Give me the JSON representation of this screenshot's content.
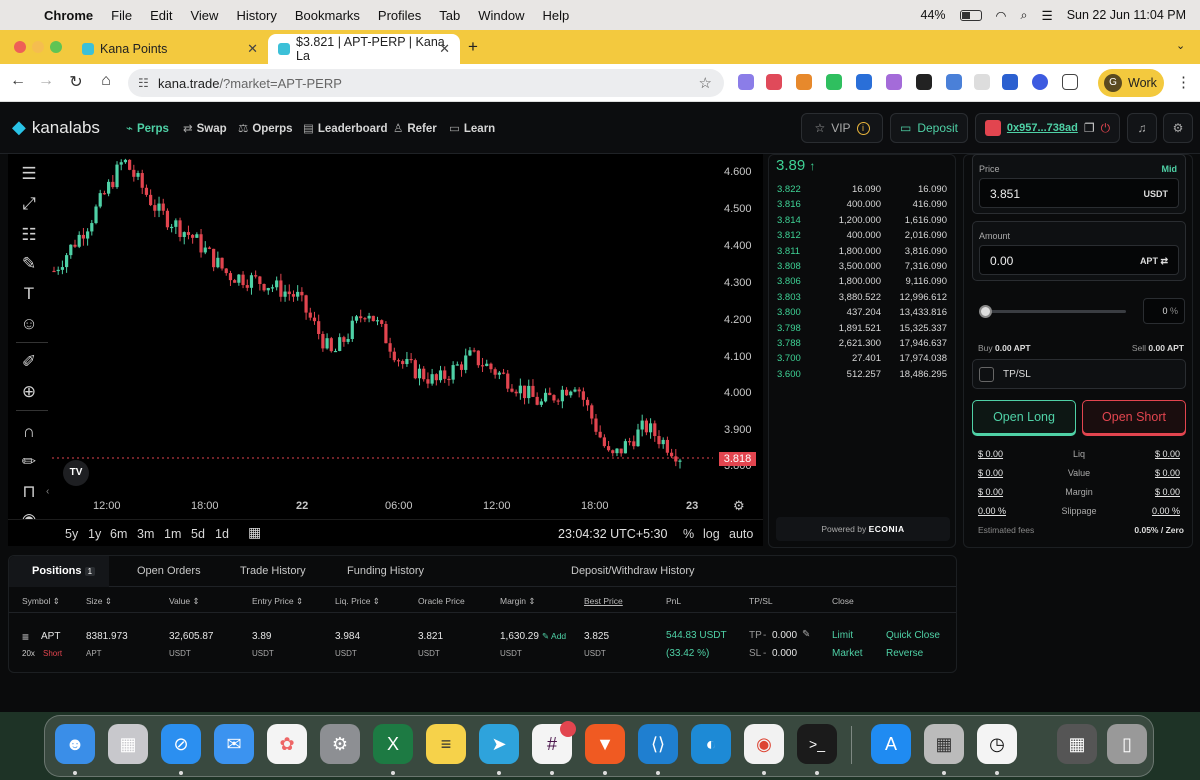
{
  "menubar": {
    "app": "Chrome",
    "items": [
      "File",
      "Edit",
      "View",
      "History",
      "Bookmarks",
      "Profiles",
      "Tab",
      "Window",
      "Help"
    ],
    "battery": "44%",
    "datetime": "Sun 22 Jun  11:04 PM"
  },
  "browser": {
    "tabs": [
      {
        "title": "Kana Points"
      },
      {
        "title": "$3.821 | APT-PERP | Kana La"
      }
    ],
    "url_host": "kana.trade",
    "url_path": "/?market=APT-PERP",
    "profile_name": "Work",
    "profile_initial": "G"
  },
  "nav": {
    "logo": "kanalabs",
    "links": [
      "Perps",
      "Swap",
      "Operps",
      "Leaderboard",
      "Refer",
      "Learn"
    ],
    "vip": "VIP",
    "deposit": "Deposit",
    "wallet": "0x957...738ad"
  },
  "chart": {
    "price_axis": [
      "4.600",
      "4.500",
      "4.400",
      "4.300",
      "4.200",
      "4.100",
      "4.000",
      "3.900",
      "3.800"
    ],
    "time_axis": [
      "12:00",
      "18:00",
      "22",
      "06:00",
      "12:00",
      "18:00",
      "23"
    ],
    "last_price": "3.818",
    "ranges": [
      "5y",
      "1y",
      "6m",
      "3m",
      "1m",
      "5d",
      "1d"
    ],
    "clock": "23:04:32 UTC+5:30",
    "toggles": [
      "%",
      "log",
      "auto"
    ]
  },
  "chart_data": {
    "type": "candlestick",
    "title": "",
    "xlabel": "",
    "ylabel": "",
    "ylim": [
      3.8,
      4.65
    ],
    "x": [
      "12:00",
      "18:00",
      "22",
      "06:00",
      "12:00",
      "18:00",
      "23"
    ],
    "close_trend": [
      4.33,
      4.46,
      4.63,
      4.49,
      4.42,
      4.32,
      4.3,
      4.26,
      4.1,
      4.23,
      4.08,
      4.03,
      4.1,
      4.04,
      3.97,
      4.03,
      3.82,
      3.91,
      3.83
    ],
    "last": 3.818
  },
  "orderbook": {
    "last_price": "3.89",
    "rows": [
      [
        "3.822",
        "16.090",
        "16.090"
      ],
      [
        "3.816",
        "400.000",
        "416.090"
      ],
      [
        "3.814",
        "1,200.000",
        "1,616.090"
      ],
      [
        "3.812",
        "400.000",
        "2,016.090"
      ],
      [
        "3.811",
        "1,800.000",
        "3,816.090"
      ],
      [
        "3.808",
        "3,500.000",
        "7,316.090"
      ],
      [
        "3.806",
        "1,800.000",
        "9,116.090"
      ],
      [
        "3.803",
        "3,880.522",
        "12,996.612"
      ],
      [
        "3.800",
        "437.204",
        "13,433.816"
      ],
      [
        "3.798",
        "1,891.521",
        "15,325.337"
      ],
      [
        "3.788",
        "2,621.300",
        "17,946.637"
      ],
      [
        "3.700",
        "27.401",
        "17,974.038"
      ],
      [
        "3.600",
        "512.257",
        "18,486.295"
      ]
    ],
    "powered_prefix": "Powered by",
    "powered_brand": "ECONIA"
  },
  "trade": {
    "price_label": "Price",
    "mid": "Mid",
    "price_value": "3.851",
    "price_unit": "USDT",
    "amount_label": "Amount",
    "amount_value": "0.00",
    "amount_unit": "APT",
    "slider_pct": "0",
    "pct_sign": "%",
    "buy_label": "Buy",
    "buy_value": "0.00 APT",
    "sell_label": "Sell",
    "sell_value": "0.00 APT",
    "tpsl": "TP/SL",
    "open_long": "Open Long",
    "open_short": "Open Short",
    "summary": [
      {
        "l": "$ 0.00",
        "m": "Liq",
        "r": "$ 0.00"
      },
      {
        "l": "$ 0.00",
        "m": "Value",
        "r": "$ 0.00"
      },
      {
        "l": "$ 0.00",
        "m": "Margin",
        "r": "$ 0.00"
      },
      {
        "l": "0.00 %",
        "m": "Slippage",
        "r": "0.00 %"
      }
    ],
    "fees_label": "Estimated fees",
    "fees_value": "0.05% / Zero"
  },
  "positions": {
    "tabs": [
      "Positions",
      "Open Orders",
      "Trade History",
      "Funding History",
      "Deposit/Withdraw History"
    ],
    "count": "1",
    "headers": [
      "Symbol",
      "Size",
      "Value",
      "Entry Price",
      "Liq. Price",
      "Oracle Price",
      "Margin",
      "Best Price",
      "PnL",
      "TP/SL",
      "Close"
    ],
    "row": {
      "symbol": "APT",
      "leverage": "20x",
      "side": "Short",
      "size": "8381.973",
      "size_unit": "APT",
      "value": "32,605.87",
      "entry": "3.89",
      "liq": "3.984",
      "oracle": "3.821",
      "margin": "1,630.29",
      "add": "Add",
      "best": "3.825",
      "usdt": "USDT",
      "pnl": "544.83 USDT",
      "pnl_pct": "(33.42 %)",
      "tp_label": "TP",
      "tp": "0.000",
      "sl_label": "SL",
      "sl": "0.000",
      "dash": "-",
      "limit": "Limit",
      "market": "Market",
      "quick_close": "Quick Close",
      "reverse": "Reverse"
    }
  },
  "colors": {
    "accent": "#4fd1a6",
    "short": "#e2454f",
    "long": "#3ed295"
  }
}
